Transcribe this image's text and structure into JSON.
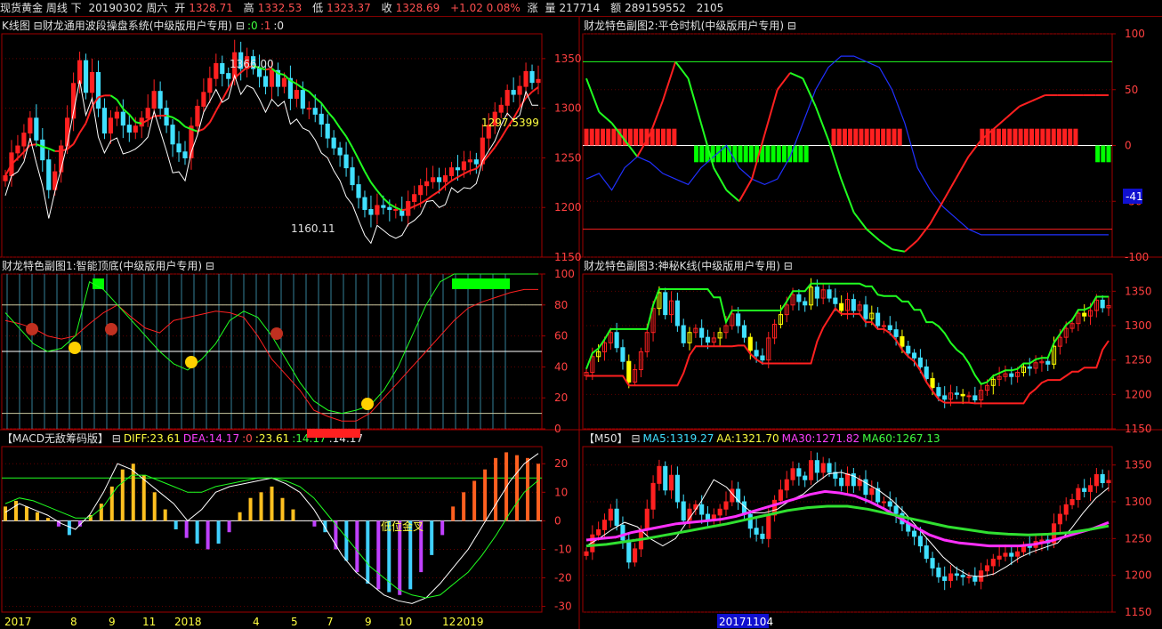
{
  "title_bar": {
    "name": "现货黄金 周线 下",
    "date": "20190302 周六",
    "open_label": "开",
    "open": "1328.71",
    "high_label": "高",
    "high": "1332.53",
    "low_label": "低",
    "low": "1323.37",
    "close_label": "收",
    "close": "1328.69",
    "change": "+1.02 0.08%",
    "change_label": "涨",
    "volume_label": "量",
    "volume": "217714",
    "amount_label": "额",
    "amount": "289159552",
    "extra": "2105"
  },
  "panels": {
    "kline": {
      "header": "K线图 ⊟财龙通用波段操盘系统(中级版用户专用) ⊟",
      "params": [
        ":0",
        ":1",
        ":0"
      ],
      "y_ticks": [
        "1350",
        "1300",
        "1250",
        "1200",
        "1150"
      ],
      "annotations": {
        "high": "1366.00",
        "low": "1160.11",
        "current": "1297.5399"
      }
    },
    "sub2": {
      "header": "财龙特色副图2:平仓时机(中级版用户专用) ⊟",
      "y_ticks": [
        "100",
        "50",
        "0",
        "-50",
        "-100"
      ],
      "badge": "-41"
    },
    "sub1": {
      "header": "财龙特色副图1:智能顶底(中级版用户专用) ⊟",
      "y_ticks": [
        "100",
        "80",
        "60",
        "40",
        "20",
        "0"
      ]
    },
    "sub3": {
      "header": "财龙特色副图3:神秘K线(中级版用户专用) ⊟",
      "y_ticks": [
        "1350",
        "1300",
        "1250",
        "1200",
        "1150"
      ]
    },
    "macd": {
      "header_name": "【MACD无敌筹码版】 ⊟",
      "diff": "DIFF:23.61",
      "dea": "DEA:14.17",
      "v0": ":0",
      "v1": ":23.61",
      "v2": ":14.17",
      "v3": ":14.17",
      "annotation": "低位金叉",
      "y_ticks": [
        "20",
        "10",
        "0",
        "-10",
        "-20",
        "-30"
      ]
    },
    "ma": {
      "header_name": "【M50】 ⊟",
      "ma5": "MA5:1319.27",
      "aa": "AA:1321.70",
      "ma30": "MA30:1271.82",
      "ma60": "MA60:1267.13",
      "y_ticks": [
        "1350",
        "1300",
        "1250",
        "1200",
        "1150"
      ]
    }
  },
  "x_axis": {
    "labels": [
      "2017",
      "8",
      "9",
      "11",
      "2018",
      "4",
      "5",
      "7",
      "9",
      "10",
      "12",
      "2019"
    ],
    "cursor_date": "20171104"
  },
  "colors": {
    "up": "#ff2020",
    "down": "#40e0ff",
    "frame": "#a00000",
    "line_red": "#ff2020",
    "line_green": "#20ff20",
    "line_blue": "#2030ff",
    "magenta": "#ff30ff",
    "yellow": "#ffff00"
  },
  "chart_data": [
    {
      "type": "candlestick",
      "panel": "kline",
      "title": "K线图",
      "ylim": [
        1150,
        1375
      ],
      "series": [
        {
          "name": "close",
          "values": [
            1232,
            1255,
            1262,
            1275,
            1290,
            1268,
            1248,
            1218,
            1236,
            1262,
            1290,
            1325,
            1348,
            1316,
            1336,
            1300,
            1275,
            1290,
            1296,
            1283,
            1276,
            1282,
            1290,
            1300,
            1317,
            1300,
            1283,
            1264,
            1256,
            1250,
            1282,
            1302,
            1316,
            1330,
            1345,
            1335,
            1330,
            1356,
            1340,
            1352,
            1340,
            1332,
            1322,
            1338,
            1322,
            1330,
            1310,
            1318,
            1300,
            1300,
            1294,
            1284,
            1270,
            1260,
            1253,
            1240,
            1223,
            1210,
            1198,
            1193,
            1202,
            1200,
            1198,
            1198,
            1192,
            1206,
            1213,
            1222,
            1226,
            1230,
            1226,
            1232,
            1240,
            1238,
            1246,
            1248,
            1244,
            1270,
            1283,
            1296,
            1303,
            1318,
            1314,
            1322,
            1337,
            1326,
            1329
          ]
        }
      ],
      "annotations": [
        {
          "label": "1366.00"
        },
        {
          "label": "1160.11"
        },
        {
          "label": "1297.5399"
        }
      ]
    },
    {
      "type": "line",
      "panel": "sub2",
      "title": "平仓时机",
      "ylim": [
        -100,
        100
      ],
      "series": [
        {
          "name": "red",
          "values": [
            20,
            35,
            60,
            80,
            70,
            40,
            10,
            -20,
            -40,
            -50,
            -45,
            -10,
            30,
            60,
            65,
            40,
            20,
            -5,
            -20,
            -10,
            10,
            30,
            40,
            30,
            20,
            10,
            -10,
            -30,
            -60,
            -85,
            -95,
            -90,
            -70,
            -50,
            -20,
            10,
            40,
            60,
            75,
            85,
            95,
            98
          ]
        },
        {
          "name": "green",
          "values": [
            60,
            30,
            20,
            5,
            -10,
            10,
            40,
            75,
            60,
            20,
            -20,
            -40,
            -50,
            -30,
            10,
            50,
            65,
            60,
            35,
            5,
            -30,
            -60,
            -75,
            -85,
            -93,
            -95,
            -85,
            -70,
            -50,
            -30,
            -10,
            5,
            15,
            25,
            35,
            40,
            45,
            45,
            45,
            45,
            45,
            45
          ]
        },
        {
          "name": "blue",
          "values": [
            -30,
            -25,
            -40,
            -20,
            -10,
            -15,
            -25,
            -30,
            -35,
            -20,
            -10,
            0,
            -20,
            -30,
            -35,
            -30,
            -10,
            20,
            50,
            70,
            80,
            80,
            75,
            70,
            50,
            20,
            -20,
            -40,
            -55,
            -65,
            -75,
            -80,
            -80,
            -80,
            -80,
            -80,
            -80,
            -80,
            -80,
            -80,
            -80,
            -80
          ]
        }
      ],
      "annotations": [
        {
          "label": "-41"
        }
      ]
    },
    {
      "type": "line",
      "panel": "sub1",
      "title": "智能顶底",
      "ylim": [
        0,
        100
      ],
      "series": [
        {
          "name": "red",
          "values": [
            70,
            68,
            65,
            60,
            58,
            60,
            68,
            75,
            80,
            72,
            65,
            62,
            70,
            72,
            74,
            76,
            75,
            72,
            60,
            45,
            35,
            25,
            12,
            8,
            5,
            5,
            10,
            20,
            30,
            40,
            50,
            60,
            70,
            78,
            82,
            85,
            88,
            90,
            90
          ]
        },
        {
          "name": "green",
          "values": [
            75,
            65,
            55,
            50,
            52,
            60,
            95,
            90,
            80,
            70,
            60,
            50,
            42,
            38,
            45,
            55,
            70,
            76,
            72,
            60,
            45,
            30,
            18,
            12,
            10,
            12,
            15,
            25,
            40,
            60,
            80,
            95,
            100,
            100,
            100,
            100,
            100,
            100,
            100
          ]
        }
      ]
    },
    {
      "type": "candlestick",
      "panel": "sub3",
      "title": "神秘K线",
      "ylim": [
        1150,
        1375
      ]
    },
    {
      "type": "bar",
      "panel": "macd",
      "title": "MACD",
      "ylim": [
        -32,
        26
      ],
      "series": [
        {
          "name": "MACD",
          "values": [
            5,
            7,
            5,
            3,
            1,
            -2,
            -5,
            -2,
            2,
            6,
            12,
            18,
            20,
            16,
            10,
            4,
            -3,
            -6,
            -8,
            -10,
            -8,
            -4,
            3,
            8,
            10,
            12,
            8,
            4,
            0,
            -2,
            -4,
            -10,
            -14,
            -18,
            -22,
            -24,
            -25,
            -26,
            -24,
            -18,
            -12,
            -5,
            5,
            10,
            14,
            18,
            22,
            24,
            23,
            22,
            20
          ]
        },
        {
          "name": "DIFF",
          "values": [
            3,
            6,
            4,
            2,
            -1,
            -3,
            2,
            10,
            20,
            18,
            14,
            10,
            6,
            0,
            4,
            10,
            12,
            13,
            14,
            15,
            13,
            10,
            4,
            -4,
            -12,
            -18,
            -22,
            -26,
            -28,
            -29,
            -27,
            -22,
            -16,
            -10,
            -2,
            6,
            14,
            20,
            23.61
          ]
        },
        {
          "name": "DEA",
          "values": [
            6,
            8,
            7,
            5,
            3,
            1,
            1,
            5,
            12,
            16,
            16,
            14,
            12,
            10,
            10,
            12,
            13,
            14,
            15,
            15,
            14,
            12,
            8,
            2,
            -4,
            -10,
            -16,
            -20,
            -24,
            -26,
            -27,
            -26,
            -22,
            -18,
            -12,
            -5,
            3,
            10,
            14.17
          ]
        }
      ],
      "annotations": [
        {
          "label": "低位金叉"
        }
      ]
    },
    {
      "type": "line",
      "panel": "ma",
      "title": "M50",
      "ylim": [
        1150,
        1375
      ],
      "series": [
        {
          "name": "MA5",
          "values": [
            1240,
            1250,
            1262,
            1272,
            1266,
            1250,
            1240,
            1250,
            1275,
            1300,
            1330,
            1320,
            1300,
            1285,
            1285,
            1290,
            1302,
            1310,
            1325,
            1338,
            1340,
            1335,
            1325,
            1315,
            1302,
            1285,
            1265,
            1245,
            1225,
            1210,
            1200,
            1198,
            1202,
            1212,
            1224,
            1232,
            1238,
            1244,
            1262,
            1285,
            1305,
            1319.27
          ]
        },
        {
          "name": "MA30",
          "values": [
            1248,
            1250,
            1252,
            1258,
            1262,
            1266,
            1270,
            1272,
            1274,
            1276,
            1280,
            1286,
            1292,
            1298,
            1304,
            1310,
            1314,
            1312,
            1308,
            1300,
            1290,
            1278,
            1266,
            1255,
            1248,
            1244,
            1242,
            1240,
            1240,
            1240,
            1242,
            1246,
            1252,
            1258,
            1264,
            1271.82
          ]
        },
        {
          "name": "MA60",
          "values": [
            1240,
            1242,
            1246,
            1250,
            1255,
            1260,
            1265,
            1270,
            1276,
            1282,
            1288,
            1292,
            1294,
            1294,
            1290,
            1284,
            1278,
            1272,
            1266,
            1262,
            1258,
            1256,
            1255,
            1256,
            1258,
            1262,
            1267.13
          ]
        }
      ]
    }
  ]
}
